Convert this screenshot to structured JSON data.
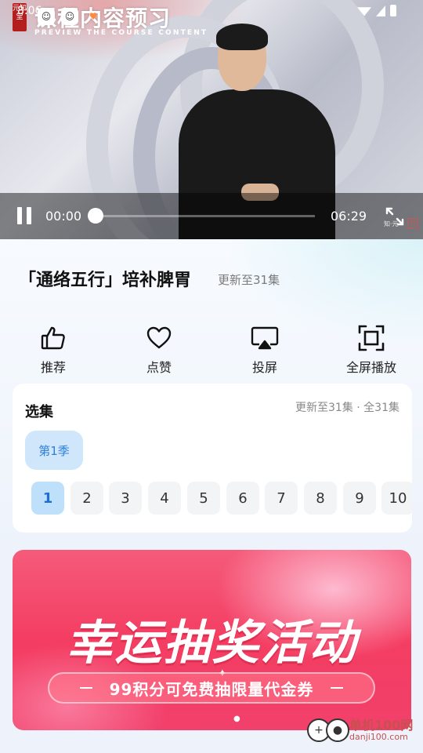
{
  "status_bar": {
    "time": "8:06"
  },
  "video": {
    "overlay_title": "课程内容预习",
    "overlay_subtitle": "PREVIEW THE COURSE CONTENT",
    "seal_text": "元知堂",
    "current_time": "00:00",
    "total_time": "06:29",
    "progress": 0.0,
    "watermark": "知·元"
  },
  "course": {
    "title": "「通络五行」培补脾胃",
    "update_note": "更新至31集"
  },
  "actions": [
    {
      "label": "推荐",
      "icon": "thumbs-up-icon"
    },
    {
      "label": "点赞",
      "icon": "heart-icon"
    },
    {
      "label": "投屏",
      "icon": "cast-icon"
    },
    {
      "label": "全屏播放",
      "icon": "fullscreen-icon"
    }
  ],
  "episodes": {
    "title": "选集",
    "meta": "更新至31集 · 全31集",
    "season": "第1季",
    "items": [
      "1",
      "2",
      "3",
      "4",
      "5",
      "6",
      "7",
      "8",
      "9",
      "10"
    ],
    "active": "1"
  },
  "banner": {
    "title": "幸运抽奖活动",
    "subtitle": "99积分可免费抽限量代金券"
  },
  "watermark_site": {
    "name": "单机100网",
    "url": "danji100.com"
  }
}
